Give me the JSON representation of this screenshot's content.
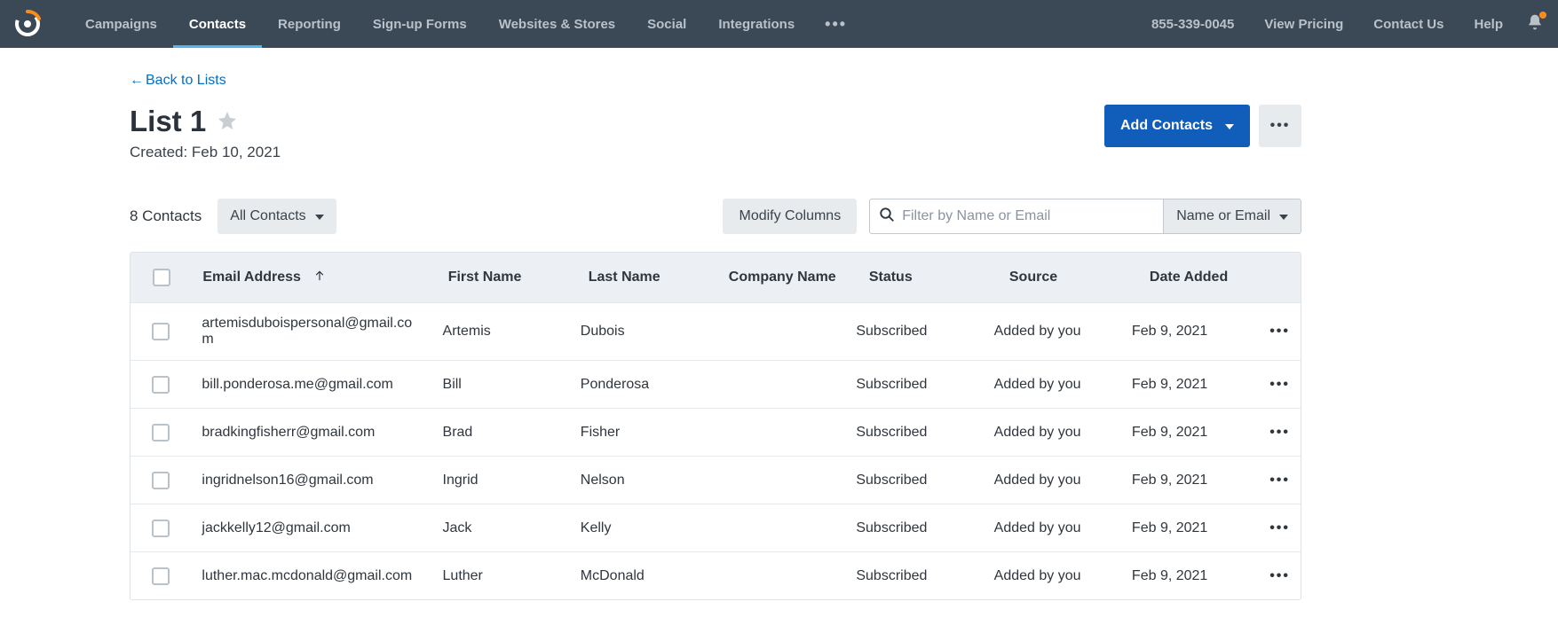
{
  "nav": {
    "items": [
      "Campaigns",
      "Contacts",
      "Reporting",
      "Sign-up Forms",
      "Websites & Stores",
      "Social",
      "Integrations"
    ],
    "activeIndex": 1
  },
  "right": {
    "phone": "855-339-0045",
    "pricing": "View Pricing",
    "contact": "Contact Us",
    "help": "Help"
  },
  "back": {
    "label": "Back to Lists"
  },
  "title": "List 1",
  "created": "Created: Feb 10, 2021",
  "actions": {
    "addContacts": "Add Contacts"
  },
  "toolbar": {
    "count": "8 Contacts",
    "filterDropdown": "All Contacts",
    "modifyColumns": "Modify Columns",
    "searchPlaceholder": "Filter by Name or Email",
    "searchSelect": "Name or Email"
  },
  "columns": {
    "email": "Email Address",
    "first": "First Name",
    "last": "Last Name",
    "company": "Company Name",
    "status": "Status",
    "source": "Source",
    "date": "Date Added"
  },
  "rows": [
    {
      "email": "artemisduboispersonal@gmail.com",
      "first": "Artemis",
      "last": "Dubois",
      "company": "",
      "status": "Subscribed",
      "source": "Added by you",
      "date": "Feb 9, 2021"
    },
    {
      "email": "bill.ponderosa.me@gmail.com",
      "first": "Bill",
      "last": "Ponderosa",
      "company": "",
      "status": "Subscribed",
      "source": "Added by you",
      "date": "Feb 9, 2021"
    },
    {
      "email": "bradkingfisherr@gmail.com",
      "first": "Brad",
      "last": "Fisher",
      "company": "",
      "status": "Subscribed",
      "source": "Added by you",
      "date": "Feb 9, 2021"
    },
    {
      "email": "ingridnelson16@gmail.com",
      "first": "Ingrid",
      "last": "Nelson",
      "company": "",
      "status": "Subscribed",
      "source": "Added by you",
      "date": "Feb 9, 2021"
    },
    {
      "email": "jackkelly12@gmail.com",
      "first": "Jack",
      "last": "Kelly",
      "company": "",
      "status": "Subscribed",
      "source": "Added by you",
      "date": "Feb 9, 2021"
    },
    {
      "email": "luther.mac.mcdonald@gmail.com",
      "first": "Luther",
      "last": "McDonald",
      "company": "",
      "status": "Subscribed",
      "source": "Added by you",
      "date": "Feb 9, 2021"
    }
  ]
}
